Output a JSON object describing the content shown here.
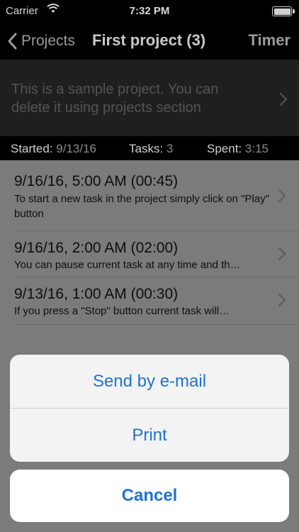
{
  "status_bar": {
    "carrier": "Carrier",
    "time": "7:32 PM"
  },
  "nav": {
    "back_label": "Projects",
    "title": "First project (3)",
    "right_label": "Timer"
  },
  "project": {
    "description": "This is a sample project. You can delete it using projects section"
  },
  "stats": {
    "started_label": "Started:",
    "started_value": "9/13/16",
    "tasks_label": "Tasks:",
    "tasks_value": "3",
    "spent_label": "Spent:",
    "spent_value": "3:15"
  },
  "tasks": [
    {
      "title": "9/16/16, 5:00 AM (00:45)",
      "subtitle": "To start a new task in the project simply click on \"Play\" button"
    },
    {
      "title": "9/16/16, 2:00 AM (02:00)",
      "subtitle": "You can pause current task at any time and th…"
    },
    {
      "title": "9/13/16, 1:00 AM (00:30)",
      "subtitle": "If you press a \"Stop\" button current task will…"
    }
  ],
  "action_sheet": {
    "email_label": "Send by e-mail",
    "print_label": "Print",
    "cancel_label": "Cancel"
  },
  "colors": {
    "accent": "#1f72d6",
    "nav_background": "#000000"
  }
}
